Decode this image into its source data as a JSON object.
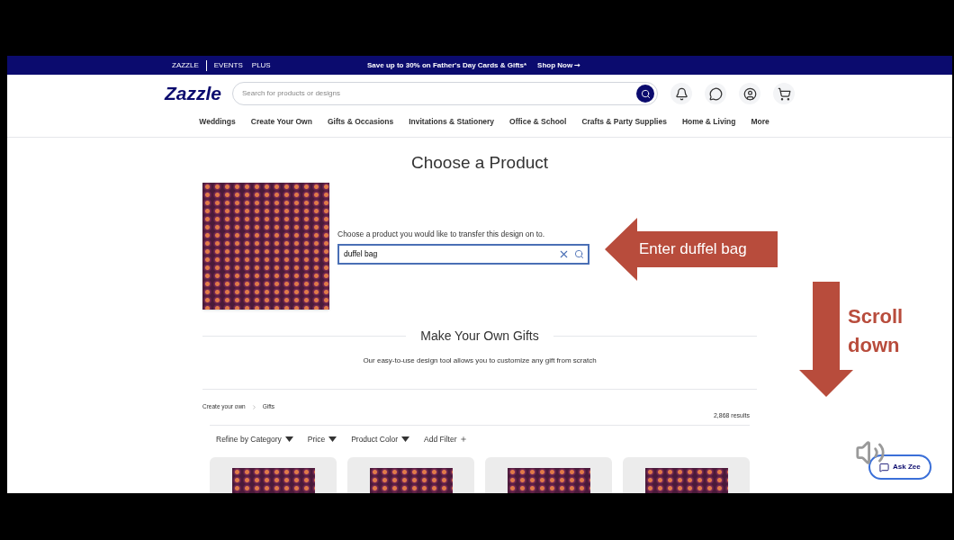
{
  "promo_bar": {
    "links": [
      "ZAZZLE",
      "EVENTS",
      "PLUS"
    ],
    "message": "Save up to 30% on Father's Day Cards & Gifts*",
    "cta": "Shop Now ➞"
  },
  "header": {
    "logo": "Zazzle",
    "search_placeholder": "Search for products or designs"
  },
  "nav": [
    "Weddings",
    "Create Your Own",
    "Gifts & Occasions",
    "Invitations & Stationery",
    "Office & School",
    "Crafts & Party Supplies",
    "Home & Living",
    "More"
  ],
  "choose": {
    "title": "Choose a Product",
    "prompt": "Choose a product you would like to transfer this design on to.",
    "search_value": "duffel bag"
  },
  "make_own": {
    "title": "Make Your Own Gifts",
    "subtitle": "Our easy-to-use design tool allows you to customize any gift from scratch"
  },
  "breadcrumb": [
    "Create your own",
    "Gifts"
  ],
  "results": "2,868 results",
  "filters": [
    {
      "label": "Refine by Category",
      "kind": "dropdown"
    },
    {
      "label": "Price",
      "kind": "dropdown"
    },
    {
      "label": "Product Color",
      "kind": "dropdown"
    },
    {
      "label": "Add Filter",
      "kind": "add"
    }
  ],
  "annotations": [
    {
      "kind": "left-arrow",
      "text": "Enter duffel bag"
    },
    {
      "kind": "down-arrow",
      "text": "Scroll down"
    }
  ],
  "chat_button": "Ask Zee"
}
